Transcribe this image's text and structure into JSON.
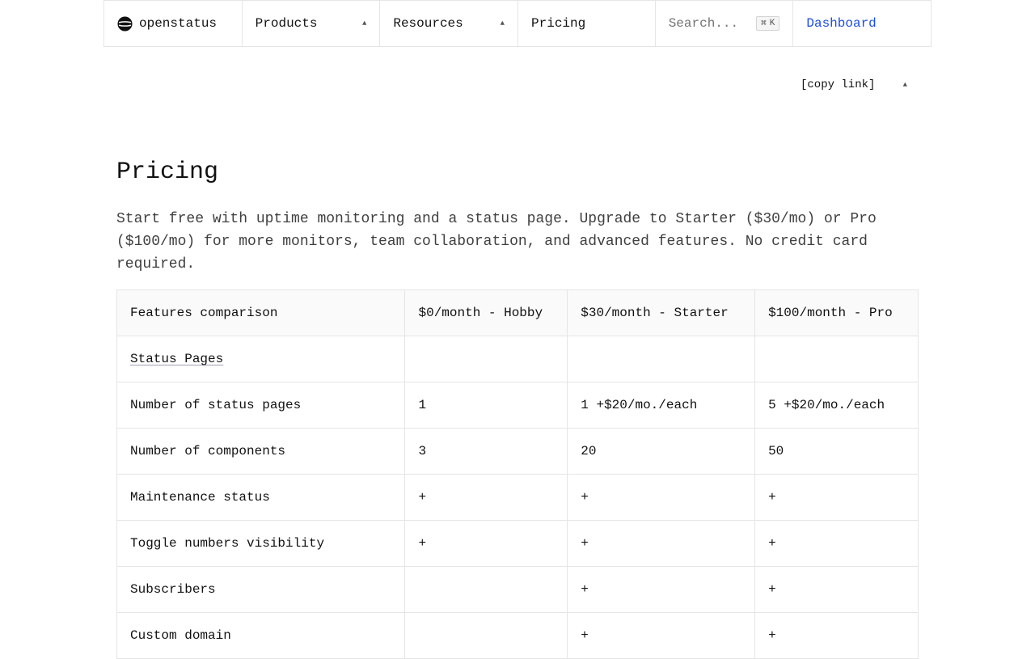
{
  "nav": {
    "brand": "openstatus",
    "products": "Products",
    "resources": "Resources",
    "pricing": "Pricing",
    "search_placeholder": "Search...",
    "search_shortcut_symbol": "⌘",
    "search_shortcut_key": "K",
    "dashboard": "Dashboard",
    "caret_icon": "▲",
    "accent_color": "#1d4ed8"
  },
  "copy_link": {
    "label": "[copy link]",
    "caret_icon": "▲"
  },
  "main": {
    "title": "Pricing",
    "description": "Start free with uptime monitoring and a status page. Upgrade to Starter ($30/mo) or Pro ($100/mo) for more monitors, team collaboration, and advanced features. No credit card required."
  },
  "table": {
    "headers": [
      "Features comparison",
      "$0/month - Hobby",
      "$30/month - Starter",
      "$100/month - Pro"
    ],
    "section": "Status Pages",
    "rows": [
      [
        "Number of status pages",
        "1",
        "1 +$20/mo./each",
        "5 +$20/mo./each"
      ],
      [
        "Number of components",
        "3",
        "20",
        "50"
      ],
      [
        "Maintenance status",
        "+",
        "+",
        "+"
      ],
      [
        "Toggle numbers visibility",
        "+",
        "+",
        "+"
      ],
      [
        "Subscribers",
        "",
        "+",
        "+"
      ],
      [
        "Custom domain",
        "",
        "+",
        "+"
      ]
    ]
  }
}
